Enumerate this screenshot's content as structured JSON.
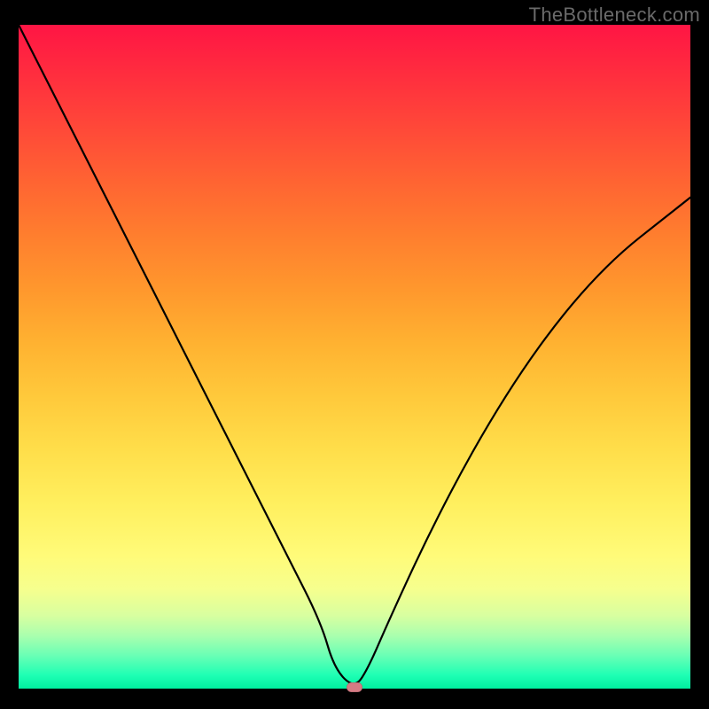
{
  "watermark": "TheBottleneck.com",
  "chart_data": {
    "type": "line",
    "title": "",
    "xlabel": "",
    "ylabel": "",
    "xlim": [
      0,
      100
    ],
    "ylim": [
      0,
      100
    ],
    "background_gradient": {
      "direction": "vertical",
      "stops": [
        {
          "pos": 0,
          "color": "#ff1544"
        },
        {
          "pos": 50,
          "color": "#ffb231"
        },
        {
          "pos": 80,
          "color": "#fffb79"
        },
        {
          "pos": 100,
          "color": "#00ee9f"
        }
      ]
    },
    "series": [
      {
        "name": "bottleneck-curve",
        "x": [
          0,
          5,
          10,
          15,
          20,
          25,
          30,
          35,
          40,
          45,
          47,
          50,
          52,
          55,
          60,
          65,
          70,
          75,
          80,
          85,
          90,
          95,
          100
        ],
        "y": [
          100,
          90,
          80,
          70,
          60,
          50,
          40,
          30,
          20,
          10,
          3,
          0,
          3,
          10,
          21,
          31,
          40,
          48,
          55,
          61,
          66,
          70,
          74
        ]
      }
    ],
    "marker": {
      "x": 50,
      "y": 0,
      "color": "#d57b84"
    }
  }
}
